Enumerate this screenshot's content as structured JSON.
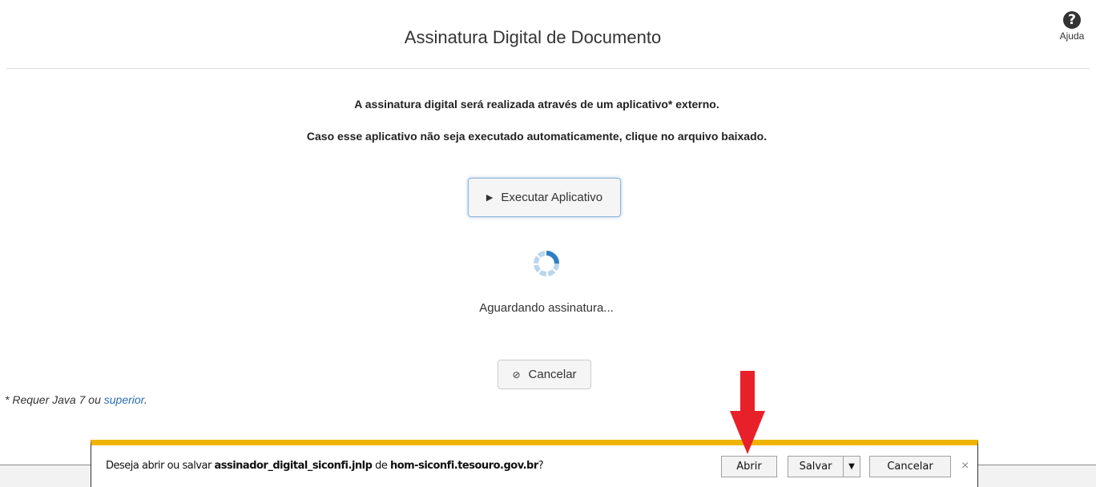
{
  "header": {
    "title": "Assinatura Digital de Documento",
    "help_icon": "?",
    "help_label": "Ajuda"
  },
  "messages": {
    "line1": "A assinatura digital será realizada através de um aplicativo* externo.",
    "line2": "Caso esse aplicativo não seja executado automaticamente, clique no arquivo baixado."
  },
  "actions": {
    "execute_label": "Executar Aplicativo",
    "execute_icon": "play-icon",
    "cancel_label": "Cancelar",
    "cancel_icon": "ban-icon"
  },
  "status": {
    "waiting_text": "Aguardando assinatura..."
  },
  "footnote": {
    "prefix": "* Requer Java 7 ou ",
    "link": "superior",
    "suffix": "."
  },
  "download_bar": {
    "prompt_prefix": "Deseja abrir ou salvar ",
    "filename": "assinador_digital_siconfi.jnlp",
    "prompt_middle": " de ",
    "domain": "hom-siconfi.tesouro.gov.br",
    "prompt_suffix": "?",
    "open_label": "Abrir",
    "save_label": "Salvar",
    "cancel_label": "Cancelar",
    "close_glyph": "×",
    "accent_color": "#f0b400"
  },
  "colors": {
    "annotation_arrow": "#e8202a",
    "spinner": "#4a90c8",
    "link": "#2a6db5"
  }
}
